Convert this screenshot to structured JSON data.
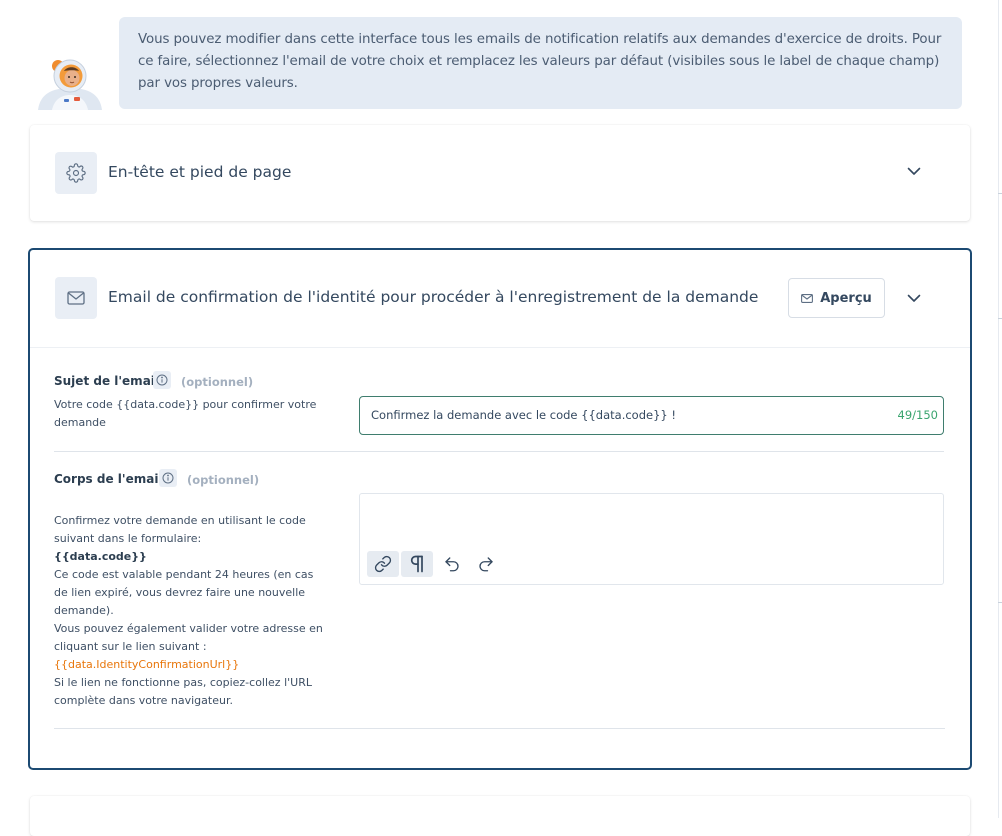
{
  "intro": {
    "text": "Vous pouvez modifier dans cette interface tous les emails de notification relatifs aux demandes d'exercice de droits. Pour ce faire, sélectionnez l'email de votre choix et remplacez les valeurs par défaut (visibiles sous le label de chaque champ) par vos propres valeurs."
  },
  "sections": {
    "header_footer": {
      "title": "En-tête et pied de page",
      "icon": "gear-icon",
      "expanded": false
    },
    "identity_email": {
      "title": "Email de confirmation de l'identité pour procéder à l'enregistrement de la demande",
      "icon": "envelope-icon",
      "preview_label": "Aperçu",
      "expanded": true,
      "subject": {
        "label": "Sujet de l'email",
        "optional": "(optionnel)",
        "default_help": "Votre code {{data.code}} pour confirmer votre demande",
        "value": "Confirmez la demande avec le code {{data.code}} !",
        "counter": "49/150"
      },
      "body": {
        "label": "Corps de l'email",
        "optional": "(optionnel)",
        "default_help": {
          "line1": "Confirmez votre demande en utilisant le code suivant dans le formulaire:",
          "code": "{{data.code}}",
          "line2": "Ce code est valable pendant 24 heures (en cas de lien expiré, vous devrez faire une nouvelle demande).",
          "line3": "Vous pouvez également valider votre adresse en cliquant sur le lien suivant :",
          "link": "{{data.IdentityConfirmationUrl}}",
          "line4": "Si le lien ne fonctionne pas, copiez-collez l'URL complète dans votre navigateur."
        },
        "value": "",
        "toolbar": [
          "link-icon",
          "paragraph-icon",
          "undo-icon",
          "redo-icon"
        ]
      }
    }
  },
  "colors": {
    "accent_border": "#1c4a72",
    "counter_green": "#3aa46e",
    "variable_orange": "#e8760b",
    "bubble_bg": "#e4ebf4"
  }
}
